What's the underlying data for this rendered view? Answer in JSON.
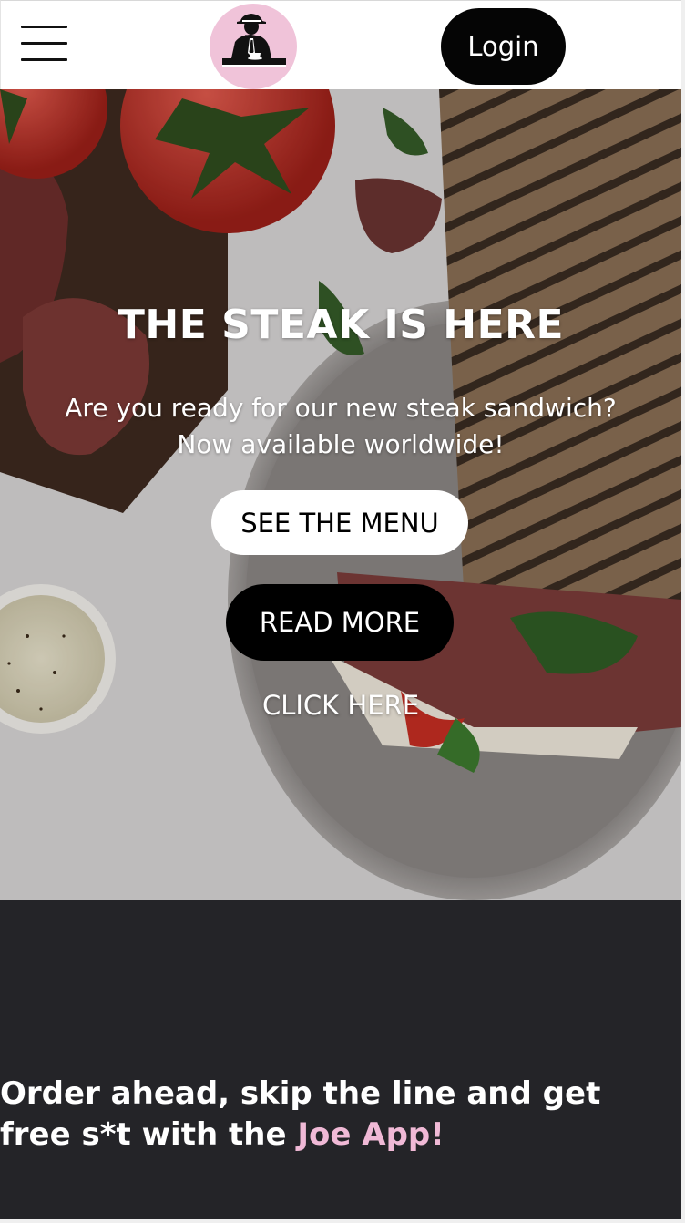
{
  "header": {
    "menu_icon": "hamburger-menu-icon",
    "logo_icon": "man-drinking-coffee-logo",
    "login_label": "Login"
  },
  "hero": {
    "title": "THE STEAK IS HERE",
    "subtitle_line1": "Are you ready for our new steak sandwich?",
    "subtitle_line2": "Now available worldwide!",
    "menu_button": "SEE THE MENU",
    "read_more_button": "READ MORE",
    "click_here_link": "CLICK HERE"
  },
  "promo": {
    "text_before": "Order ahead, skip the line and get free s*t with the ",
    "text_accent": "Joe App!"
  },
  "colors": {
    "logo_bg": "#f0c3d9",
    "accent_pink": "#f0b9d6",
    "promo_bg": "#242428",
    "button_dark": "#000000"
  }
}
